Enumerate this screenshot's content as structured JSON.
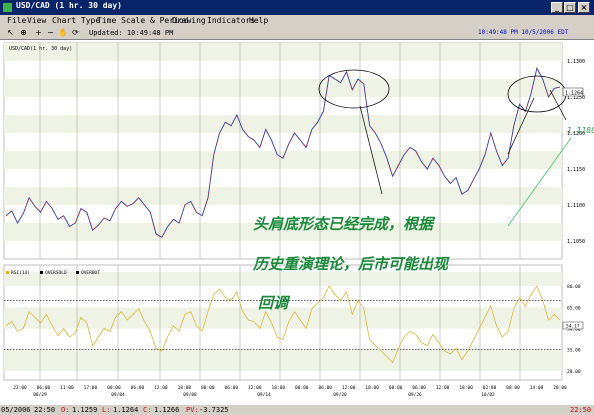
{
  "window": {
    "title": "USD/CAD (1 hr.  30 day)",
    "minimize": "_",
    "maximize": "□",
    "close": "×"
  },
  "menu": [
    "File",
    "View",
    "Chart Type",
    "Time Scale & Period",
    "Drawing",
    "Indicators",
    "Help"
  ],
  "toolbar": {
    "updated": "Updated: 10:49:48 PM",
    "clock": "10:49:48 PM  10/5/2006 EDT"
  },
  "price_panel": {
    "legend": "USD/CAD(1 hr.  30 day)",
    "y_ticks": [
      "1.1300",
      "1.1250",
      "1.1200",
      "1.1150",
      "1.1100",
      "1.1050"
    ],
    "current_price": "1.1264",
    "trendline_label": "1.1180"
  },
  "rsi_panel": {
    "legend": [
      "RSI(14)",
      "OVERSOLD",
      "OVERBOT"
    ],
    "y_ticks": [
      "80.00",
      "65.00",
      "50.00",
      "35.00",
      "20.00"
    ],
    "current_value": "54.17"
  },
  "x_axis": {
    "hours": [
      "23:00",
      "06:00",
      "11:00",
      "17:00",
      "00:00",
      "06:00",
      "12:00",
      "18:00",
      "00:00",
      "06:00",
      "12:00",
      "18:00",
      "00:00",
      "06:00",
      "12:00",
      "18:00",
      "00:00",
      "06:00",
      "12:00",
      "18:00",
      "02:00",
      "08:00",
      "14:00",
      "20:00"
    ],
    "dates": [
      "08/29",
      "09/04",
      "09/08",
      "09/14",
      "09/20",
      "09/26",
      "10/02"
    ]
  },
  "annotation": {
    "line1": "头肩底形态已经完成，根据",
    "line2": "历史重演理论，后市可能出现",
    "line3": "回调",
    "color": "#1a8a3a"
  },
  "status": {
    "date": "05/2006",
    "time": "22:50",
    "open_label": "O:",
    "open": "1.1259",
    "low_label": "L:",
    "low": "1.1264",
    "close_label": "C:",
    "close": "1.1266",
    "pv_label": "PV:",
    "pv": "-3.7325",
    "right": "22:50"
  },
  "chart_data": {
    "type": "line",
    "title": "USD/CAD(1 hr.  30 day)",
    "ylim": [
      1.1025,
      1.1325
    ],
    "price": [
      1.1085,
      1.1092,
      1.1075,
      1.1088,
      1.111,
      1.1098,
      1.109,
      1.1105,
      1.1095,
      1.108,
      1.1085,
      1.107,
      1.1075,
      1.1095,
      1.109,
      1.1065,
      1.1072,
      1.1082,
      1.1078,
      1.1095,
      1.1105,
      1.1098,
      1.1102,
      1.111,
      1.11,
      1.109,
      1.106,
      1.1055,
      1.107,
      1.108,
      1.1075,
      1.11,
      1.1105,
      1.109,
      1.1085,
      1.111,
      1.117,
      1.12,
      1.1215,
      1.121,
      1.1225,
      1.1205,
      1.1195,
      1.119,
      1.118,
      1.1205,
      1.119,
      1.117,
      1.1165,
      1.1185,
      1.12,
      1.119,
      1.118,
      1.1205,
      1.1215,
      1.123,
      1.128,
      1.1275,
      1.127,
      1.1285,
      1.126,
      1.1275,
      1.1268,
      1.121,
      1.12,
      1.1185,
      1.1165,
      1.114,
      1.1155,
      1.117,
      1.118,
      1.1175,
      1.116,
      1.115,
      1.1165,
      1.1155,
      1.114,
      1.113,
      1.1138,
      1.1115,
      1.112,
      1.1135,
      1.115,
      1.117,
      1.12,
      1.1175,
      1.1155,
      1.1165,
      1.121,
      1.124,
      1.123,
      1.1255,
      1.129,
      1.1275,
      1.125,
      1.1262,
      1.1264
    ],
    "rsi": [
      52,
      55,
      48,
      50,
      62,
      58,
      54,
      60,
      52,
      45,
      50,
      44,
      47,
      58,
      54,
      38,
      44,
      50,
      48,
      58,
      62,
      56,
      60,
      64,
      55,
      48,
      36,
      34,
      44,
      52,
      48,
      60,
      62,
      52,
      48,
      62,
      74,
      78,
      72,
      70,
      76,
      62,
      56,
      55,
      50,
      62,
      54,
      44,
      42,
      55,
      62,
      56,
      50,
      64,
      68,
      72,
      80,
      74,
      70,
      76,
      60,
      70,
      64,
      42,
      38,
      34,
      30,
      26,
      36,
      44,
      48,
      46,
      40,
      38,
      46,
      40,
      34,
      32,
      36,
      28,
      34,
      42,
      50,
      58,
      66,
      52,
      44,
      48,
      64,
      72,
      66,
      74,
      80,
      70,
      56,
      60,
      56
    ],
    "rsi_ylim": [
      15,
      90
    ],
    "overbought": 70,
    "oversold": 35
  }
}
